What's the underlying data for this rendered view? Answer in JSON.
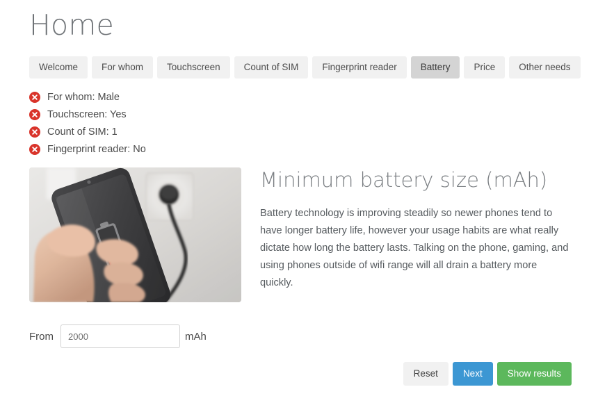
{
  "page": {
    "title": "Home"
  },
  "tabs": {
    "items": [
      {
        "label": "Welcome",
        "active": false
      },
      {
        "label": "For whom",
        "active": false
      },
      {
        "label": "Touchscreen",
        "active": false
      },
      {
        "label": "Count of SIM",
        "active": false
      },
      {
        "label": "Fingerprint reader",
        "active": false
      },
      {
        "label": "Battery",
        "active": true
      },
      {
        "label": "Price",
        "active": false
      },
      {
        "label": "Other needs",
        "active": false
      }
    ]
  },
  "selections": {
    "icon": "remove-circle-icon",
    "icon_color": "#d9342b",
    "items": [
      {
        "label": "For whom: Male"
      },
      {
        "label": "Touchscreen: Yes"
      },
      {
        "label": "Count of SIM: 1"
      },
      {
        "label": "Fingerprint reader: No"
      }
    ]
  },
  "main": {
    "image_alt": "hand-holding-charging-phone-photo",
    "heading": "Minimum battery size (mAh)",
    "body": "Battery technology is improving steadily so newer phones tend to have longer battery life, however your usage habits are what really dictate how long the battery lasts. Talking on the phone, gaming, and using phones outside of wifi range will all drain a battery more quickly.",
    "from_label": "From",
    "amount_value": "2000",
    "amount_placeholder": "",
    "unit_label": "mAh"
  },
  "footer": {
    "reset_label": "Reset",
    "next_label": "Next",
    "show_results_label": "Show results",
    "primary_color": "#3c97d3",
    "success_color": "#5cb85c"
  }
}
